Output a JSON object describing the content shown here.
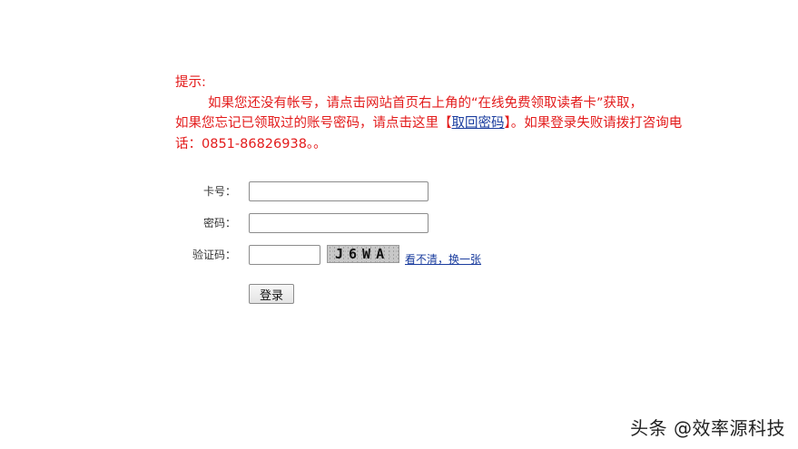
{
  "notice": {
    "title": "提示:",
    "line1": "如果您还没有帐号，请点击网站首页右上角的“在线免费领取读者卡”获取，",
    "line2_before": "如果您忘记已领取过的账号密码，请点击这里",
    "bracket_open": "【",
    "recover_link": "取回密码",
    "bracket_close": "】",
    "line2_after": "。如果登录失败请拨打咨询电话：0851-86826938。。"
  },
  "form": {
    "card_label": "卡号：",
    "card_value": "",
    "password_label": "密码：",
    "password_value": "",
    "captcha_label": "验证码：",
    "captcha_value": "",
    "captcha_image_text": "J6WA",
    "refresh_link": "看不清，换一张",
    "login_button": "登录"
  },
  "watermark": "头条 @效率源科技",
  "colors": {
    "notice_text": "#e31b1b",
    "link": "#1a3c9e"
  }
}
